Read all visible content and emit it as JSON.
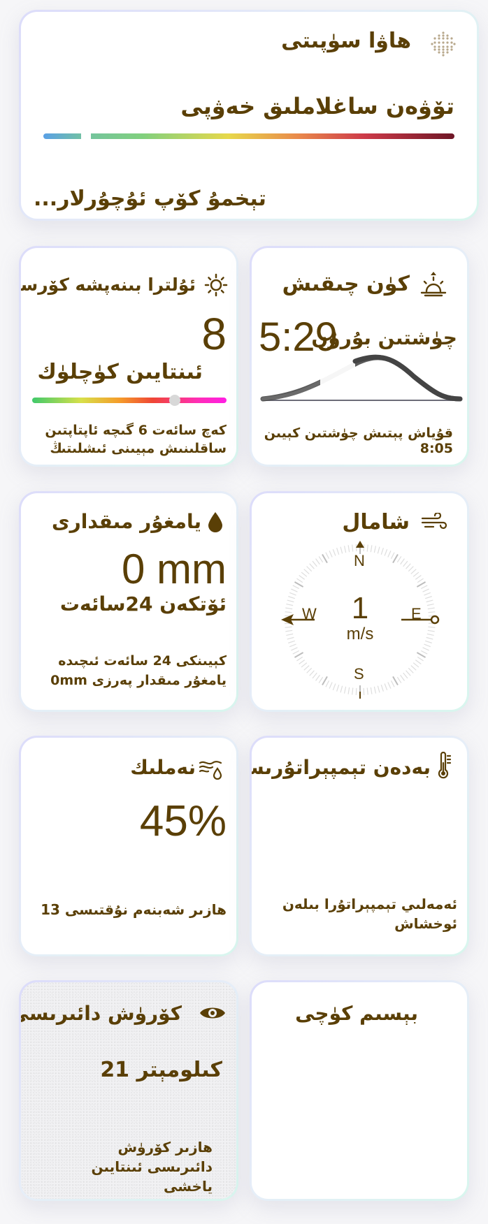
{
  "air": {
    "title": "هاۋا سۈپىتى",
    "status": "تۆۋەن ساغلاملىق خەۋپى",
    "more": "تېخمۇ كۆپ ئۇچۇرلار...",
    "colors": [
      "#5aa0e6",
      "#78cf8a",
      "#e8d84a",
      "#e9884b",
      "#cd3949",
      "#6e1626"
    ]
  },
  "uv": {
    "title": "ئۇلترا بىنەپشە كۆرسەتكۈچ",
    "value": "8",
    "level": "ئىنتايىن كۈچلۈك",
    "level_fraction": 0.73,
    "note": "كەچ سائەت 6 گىچە ئاپتاپتىن ساقلىنىش مېيىنى ئىشلىتىڭ"
  },
  "sun": {
    "title": "كۈن چىقىش",
    "time": "5:29",
    "label": "چۈشتىن بۇرۇن",
    "note": "قۇياش پېتىش چۈشتىن كېيىن 8:05"
  },
  "rain": {
    "title": "يامغۇر مىقدارى",
    "value": "0 mm",
    "period": "ئۆتكەن 24سائەت",
    "note": "كېيىنكى 24 سائەت ئىچىدە يامغۇر مىقدار پەرزى 0mm"
  },
  "wind": {
    "title": "شامال",
    "speed": "1",
    "unit": "m/s",
    "north": "N",
    "south": "S",
    "east": "E",
    "west": "W"
  },
  "humidity": {
    "title": "نەملىك",
    "value": "45%",
    "note": "ھازىر شەبنەم نۇقتىسى 13"
  },
  "feels": {
    "title": "بەدەن تېمپېراتۇرىسى",
    "note": "ئەمەلىي تېمپېراتۇرا بىلەن ئوخشاش"
  },
  "visibility": {
    "title": "كۆرۈش دائىرىسى",
    "value": "21 كىلومېتر",
    "note": "ھازىر كۆرۈش دائىرىسى ئىنتايىن ياخشى"
  },
  "pressure": {
    "title": "بېسىم كۈچى"
  },
  "theme": {
    "text": "#5a3f06",
    "icon": "#5a3f06"
  }
}
